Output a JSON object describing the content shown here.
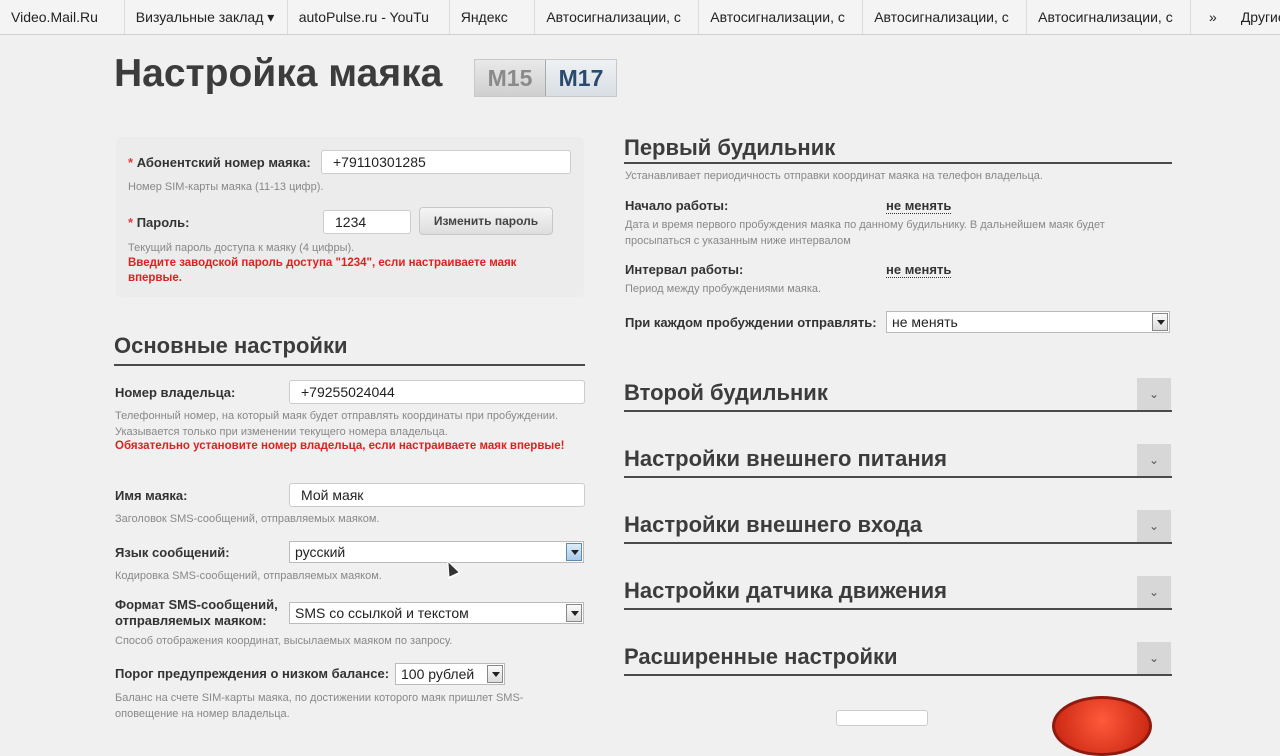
{
  "bookmarks": [
    "Video.Mail.Ru",
    "Визуальные заклад ▾",
    "autoPulse.ru - YouTu",
    "Яндекс",
    "Автосигнализации, с",
    "Автосигнализации, с",
    "Автосигнализации, с",
    "Автосигнализации, с"
  ],
  "bookmarks_more": "»",
  "bookmarks_other": "Другие закладки",
  "page_title": "Настройка маяка",
  "models": [
    "M15",
    "M17"
  ],
  "active_model": "M17",
  "auth": {
    "phone_label": "Абонентский номер маяка:",
    "phone_value": "+79110301285",
    "phone_hint": "Номер SIM-карты маяка (11-13 цифр).",
    "password_label": "Пароль:",
    "password_value": "1234",
    "change_password_button": "Изменить пароль",
    "password_hint": "Текущий пароль доступа к маяку (4 цифры).",
    "password_warning": "Введите заводской пароль доступа \"1234\", если настраиваете маяк впервые.",
    "required_mark": "*"
  },
  "basic": {
    "title": "Основные настройки",
    "owner_label": "Номер владельца:",
    "owner_value": "+79255024044",
    "owner_hint": "Телефонный номер, на который маяк будет отправлять координаты при пробуждении. Указывается только при изменении текущего номера владельца.",
    "owner_warning": "Обязательно установите номер владельца, если настраиваете маяк впервые!",
    "name_label": "Имя маяка:",
    "name_value": "Мой маяк",
    "name_hint": "Заголовок SMS-сообщений, отправляемых маяком.",
    "lang_label": "Язык сообщений:",
    "lang_value": "русский",
    "lang_hint": "Кодировка SMS-сообщений, отправляемых маяком.",
    "format_label": "Формат SMS-сообщений, отправляемых маяком:",
    "format_value": "SMS со ссылкой и текстом",
    "format_hint": "Способ отображения координат, высылаемых маяком по запросу.",
    "balance_label": "Порог предупреждения о низком балансе:",
    "balance_value": "100 рублей",
    "balance_hint": "Баланс на счете SIM-карты маяка, по достижении которого маяк пришлет SMS-оповещение на номер владельца."
  },
  "alarm1": {
    "title": "Первый будильник",
    "subtitle": "Устанавливает периодичность отправки координат маяка на телефон владельца.",
    "start_label": "Начало работы:",
    "start_value": "не менять",
    "start_hint": "Дата и время первого пробуждения маяка по данному будильнику. В дальнейшем маяк будет просыпаться с указанным ниже интервалом",
    "interval_label": "Интервал работы:",
    "interval_value": "не менять",
    "interval_hint": "Период между пробуждениями маяка.",
    "send_label": "При каждом пробуждении отправлять:",
    "send_value": "не менять"
  },
  "collapsed_sections": [
    "Второй будильник",
    "Настройки внешнего питания",
    "Настройки внешнего входа",
    "Настройки датчика движения",
    "Расширенные настройки"
  ],
  "toggle_glyph": "⌄"
}
